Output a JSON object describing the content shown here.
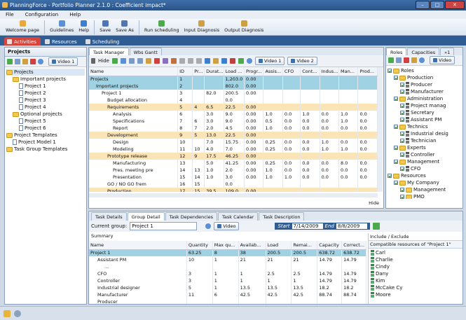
{
  "window": {
    "title": "PlanningForce - Portfolio Planner 2.1.0 : Coefficient impact*"
  },
  "menu": [
    "File",
    "Configuration",
    "Help"
  ],
  "toolbar": [
    {
      "label": "Welcome page",
      "color": "#e8a93a"
    },
    {
      "label": "Guidelines",
      "color": "#5b8fd6"
    },
    {
      "label": "Help",
      "color": "#3a7fd0"
    },
    {
      "label": "Save",
      "color": "#4f77b8"
    },
    {
      "label": "Save As",
      "color": "#4f77b8"
    },
    {
      "label": "Run scheduling",
      "color": "#4caa4c"
    },
    {
      "label": "Input Diagnosis",
      "color": "#d0a040"
    },
    {
      "label": "Output Diagnosis",
      "color": "#d0a040"
    }
  ],
  "main_tabs": [
    {
      "label": "Activities",
      "active": true
    },
    {
      "label": "Resources",
      "active": false
    },
    {
      "label": "Scheduling",
      "active": false
    }
  ],
  "projects_panel": {
    "title": "Projects",
    "video": "Video 1",
    "tree": [
      {
        "label": "Projects",
        "indent": 0,
        "type": "folder",
        "sel": true
      },
      {
        "label": "Important projects",
        "indent": 1,
        "type": "folder"
      },
      {
        "label": "Project 1",
        "indent": 2,
        "type": "doc"
      },
      {
        "label": "Project 2",
        "indent": 2,
        "type": "doc"
      },
      {
        "label": "Project 3",
        "indent": 2,
        "type": "doc"
      },
      {
        "label": "Project 4",
        "indent": 2,
        "type": "doc"
      },
      {
        "label": "Optional projects",
        "indent": 1,
        "type": "folder"
      },
      {
        "label": "Project 5",
        "indent": 2,
        "type": "doc"
      },
      {
        "label": "Project 6",
        "indent": 2,
        "type": "doc"
      },
      {
        "label": "Project Templates",
        "indent": 0,
        "type": "folder"
      },
      {
        "label": "Project Model 1",
        "indent": 1,
        "type": "doc"
      },
      {
        "label": "Task Group Templates",
        "indent": 0,
        "type": "folder"
      }
    ]
  },
  "task_manager": {
    "tabs": [
      "Task Manager",
      "Wbs Gantt"
    ],
    "hide": "Hide",
    "video1": "Video 1",
    "video2": "Video 2",
    "hide_bottom": "Hide",
    "columns": [
      "Name",
      "ID",
      "Pr...",
      "Durat...",
      "Load ...",
      "Progr...",
      "Assis...",
      "CFO",
      "Cont...",
      "Indus...",
      "Man...",
      "Prod..."
    ],
    "rows": [
      {
        "cells": [
          "Projects",
          "1",
          "",
          "",
          "1,203.0",
          "0.00",
          "",
          "",
          "",
          "",
          "",
          ""
        ],
        "indent": 0,
        "style": "sel"
      },
      {
        "cells": [
          "Important projects",
          "2",
          "",
          "",
          "802.0",
          "0.00",
          "",
          "",
          "",
          "",
          "",
          ""
        ],
        "indent": 1,
        "style": "sel"
      },
      {
        "cells": [
          "Project 1",
          "3",
          "",
          "82.0",
          "200.5",
          "0.00",
          "",
          "",
          "",
          "",
          "",
          ""
        ],
        "indent": 2,
        "style": "p"
      },
      {
        "cells": [
          "Budget allocation",
          "4",
          "",
          "",
          "0.0",
          "",
          "",
          "",
          "",
          "",
          "",
          ""
        ],
        "indent": 3,
        "style": "p"
      },
      {
        "cells": [
          "Requirements",
          "5",
          "4",
          "6.5",
          "22.5",
          "0.00",
          "",
          "",
          "",
          "",
          "",
          ""
        ],
        "indent": 3,
        "style": "grp"
      },
      {
        "cells": [
          "Analysis",
          "6",
          "",
          "3.0",
          "9.0",
          "0.00",
          "1.0",
          "0.0",
          "1.0",
          "0.0",
          "1.0",
          "0.0"
        ],
        "indent": 4,
        "style": "p"
      },
      {
        "cells": [
          "Specifications",
          "7",
          "6",
          "3.0",
          "9.0",
          "0.00",
          "0.5",
          "0.0",
          "0.0",
          "0.0",
          "1.0",
          "0.0"
        ],
        "indent": 4,
        "style": "p"
      },
      {
        "cells": [
          "Report",
          "8",
          "7",
          "2.0",
          "4.5",
          "0.00",
          "1.0",
          "0.0",
          "0.0",
          "0.0",
          "0.0",
          "0.0"
        ],
        "indent": 4,
        "style": "p"
      },
      {
        "cells": [
          "Development",
          "9",
          "5",
          "13.0",
          "22.5",
          "0.00",
          "",
          "",
          "",
          "",
          "",
          ""
        ],
        "indent": 3,
        "style": "grp"
      },
      {
        "cells": [
          "Design",
          "10",
          "",
          "7.0",
          "15.75",
          "0.00",
          "0.25",
          "0.0",
          "0.0",
          "1.0",
          "0.0",
          "0.0"
        ],
        "indent": 4,
        "style": "p"
      },
      {
        "cells": [
          "Modeling",
          "11",
          "10",
          "4.0",
          "7.0",
          "0.00",
          "0.25",
          "0.0",
          "0.0",
          "1.0",
          "1.0",
          "0.0"
        ],
        "indent": 4,
        "style": "p"
      },
      {
        "cells": [
          "Prototype release",
          "12",
          "9",
          "17.5",
          "46.25",
          "0.00",
          "",
          "",
          "",
          "",
          "",
          ""
        ],
        "indent": 3,
        "style": "grp"
      },
      {
        "cells": [
          "Manufacturing",
          "13",
          "",
          "5.0",
          "41.25",
          "0.00",
          "0.25",
          "0.0",
          "0.0",
          "0.0",
          "8.0",
          "0.0"
        ],
        "indent": 4,
        "style": "p"
      },
      {
        "cells": [
          "Pres. meeting pre",
          "14",
          "13",
          "1.0",
          "2.0",
          "0.00",
          "1.0",
          "0.0",
          "0.0",
          "0.0",
          "0.0",
          "0.0"
        ],
        "indent": 4,
        "style": "p"
      },
      {
        "cells": [
          "Presentation",
          "15",
          "14",
          "1.0",
          "3.0",
          "0.00",
          "1.0",
          "1.0",
          "0.0",
          "0.0",
          "0.0",
          "0.0"
        ],
        "indent": 4,
        "style": "p"
      },
      {
        "cells": [
          "GO / NO GO frem",
          "16",
          "15",
          "",
          "0.0",
          "",
          "",
          "",
          "",
          "",
          "",
          ""
        ],
        "indent": 3,
        "style": "p"
      },
      {
        "cells": [
          "Production",
          "17",
          "15",
          "39.5",
          "109.0",
          "0.00",
          "",
          "",
          "",
          "",
          "",
          ""
        ],
        "indent": 3,
        "style": "grp"
      }
    ]
  },
  "roles_panel": {
    "tabs": [
      "Roles",
      "Capacities"
    ],
    "tab_more": "»1",
    "video": "Video",
    "tree": [
      {
        "label": "Roles",
        "indent": 0,
        "type": "folder"
      },
      {
        "label": "Production",
        "indent": 1,
        "type": "folder"
      },
      {
        "label": "Producer",
        "indent": 2,
        "type": "person"
      },
      {
        "label": "Manufacturer",
        "indent": 2,
        "type": "person"
      },
      {
        "label": "Administration",
        "indent": 1,
        "type": "folder"
      },
      {
        "label": "Project manag",
        "indent": 2,
        "type": "person"
      },
      {
        "label": "Secretary",
        "indent": 2,
        "type": "person"
      },
      {
        "label": "Assistant PM",
        "indent": 2,
        "type": "person"
      },
      {
        "label": "Technics",
        "indent": 1,
        "type": "folder"
      },
      {
        "label": "Industrial desig",
        "indent": 2,
        "type": "person"
      },
      {
        "label": "Technician",
        "indent": 2,
        "type": "person"
      },
      {
        "label": "Experts",
        "indent": 1,
        "type": "folder"
      },
      {
        "label": "Controller",
        "indent": 2,
        "type": "person"
      },
      {
        "label": "Management",
        "indent": 1,
        "type": "folder"
      },
      {
        "label": "CFO",
        "indent": 2,
        "type": "person"
      },
      {
        "label": "Resources",
        "indent": 0,
        "type": "folder"
      },
      {
        "label": "My Company",
        "indent": 1,
        "type": "folder"
      },
      {
        "label": "Management",
        "indent": 2,
        "type": "folder"
      },
      {
        "label": "PMO",
        "indent": 2,
        "type": "folder"
      }
    ]
  },
  "bottom": {
    "tabs": [
      "Task Details",
      "Group Detail",
      "Task Dependencies",
      "Task Calendar",
      "Task Description"
    ],
    "current_group_label": "Current group:",
    "current_group": "Project 1",
    "video": "Video",
    "start_label": "Start",
    "start": "7/14/2009",
    "end_label": "End",
    "end": "8/8/2009",
    "summary_title": "Summary",
    "summary_columns": [
      "Name",
      "Quantity",
      "Max qu...",
      "Availab...",
      "Load",
      "Remai...",
      "Capacity",
      "Correct..."
    ],
    "summary_rows": [
      {
        "cells": [
          "Project 1",
          "63.25",
          "8",
          "38",
          "200.5",
          "200.5",
          "638.72",
          "638.72"
        ],
        "indent": 0,
        "sel": true
      },
      {
        "cells": [
          "Assistant PM",
          "10",
          "1",
          "21",
          "21",
          "21",
          "14.79",
          "14.79"
        ],
        "indent": 1,
        "cap": "red"
      },
      {
        "cells": [
          "...",
          "",
          "",
          "",
          "",
          "",
          "",
          ""
        ],
        "indent": 2
      },
      {
        "cells": [
          "CFO",
          "3",
          "1",
          "1",
          "2.5",
          "2.5",
          "14.79",
          "14.79"
        ],
        "indent": 1,
        "cap": "red"
      },
      {
        "cells": [
          "Controller",
          "3",
          "1",
          "1",
          "1",
          "1",
          "14.79",
          "14.79"
        ],
        "indent": 1,
        "cap": "red"
      },
      {
        "cells": [
          "Industrial designer",
          "5",
          "1",
          "13.5",
          "13.5",
          "13.5",
          "18.2",
          "18.2"
        ],
        "indent": 1,
        "cap": "green"
      },
      {
        "cells": [
          "Manufacturer",
          "11",
          "6",
          "42.5",
          "42.5",
          "42.5",
          "88.74",
          "88.74"
        ],
        "indent": 1,
        "cap": "green"
      },
      {
        "cells": [
          "Producer",
          "",
          "",
          "",
          "",
          "",
          "",
          ""
        ],
        "indent": 1,
        "cap": "green"
      }
    ],
    "include_title": "Include / Exclude",
    "compatible_header": "Compatible resources of \"Project 1\"",
    "compatible": [
      "Carl",
      "Charlie",
      "Cindy",
      "Dany",
      "Kim",
      "McCake Cy",
      "Moore"
    ]
  }
}
